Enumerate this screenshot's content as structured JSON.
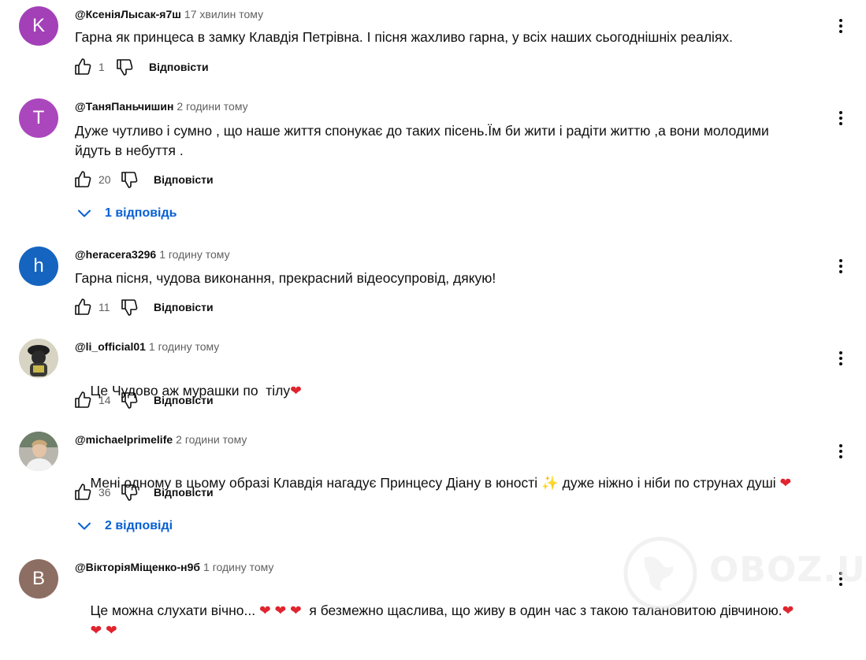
{
  "reply_label": "Відповісти",
  "colors": {
    "avatar_k": "#a340b8",
    "avatar_t": "#ab47bc",
    "avatar_h": "#1565c0",
    "avatar_b": "#8d6e63",
    "reply_link": "#065fd4",
    "heart": "#e0242e"
  },
  "icons": {
    "like": "thumb-up-icon",
    "dislike": "thumb-down-icon",
    "more": "more-vert-icon",
    "expand": "chevron-down-icon"
  },
  "comments": [
    {
      "avatar_letter": "K",
      "author": "@КсеніяЛысак-я7ш",
      "time": "17 хвилин тому",
      "text": "Гарна як принцеса в замку Клавдія Петрівна. І пісня жахливо гарна, у всіх наших сьогоднішніх реаліях.",
      "likes": "1"
    },
    {
      "avatar_letter": "T",
      "author": "@ТаняПаньчишин",
      "time": "2 години тому",
      "text_line1": "Дуже чутливо і сумно , що наше життя спонукає до таких пісень.Їм би жити і радіти життю ,а вони молодими",
      "text_line2": "йдуть в небуття .",
      "likes": "20",
      "replies": "1 відповідь"
    },
    {
      "avatar_letter": "h",
      "author": "@heracera3296",
      "time": "1 годину тому",
      "text": "Гарна пісня, чудова виконання, прекрасний відеосупровід, дякую!",
      "likes": "11"
    },
    {
      "author": "@li_official01",
      "time": "1 годину тому",
      "text": "Це Чудово аж мурашки по  тілу",
      "emoji": "❤",
      "likes": "14"
    },
    {
      "author": "@michaelprimelife",
      "time": "2 години тому",
      "text_a": "Мені одному в цьому образі Клавдія нагадує Принцесу Діану в юності ",
      "emoji_a": "✨",
      "text_b": " дуже ніжно і ніби по струнах душі ",
      "emoji_b": "❤",
      "likes": "36",
      "replies": "2 відповіді"
    },
    {
      "avatar_letter": "B",
      "author": "@ВікторіяМіщенко-н9б",
      "time": "1 годину тому",
      "text_a": "Це можна слухати вічно... ",
      "hearts_a": "❤ ❤ ❤",
      "text_b": "  я безмежно щаслива, що живу в один час з такою талановитою дівчиною.",
      "heart_b": "❤",
      "hearts_line2": "❤ ❤"
    }
  ],
  "watermark": "OBOZ.UA"
}
